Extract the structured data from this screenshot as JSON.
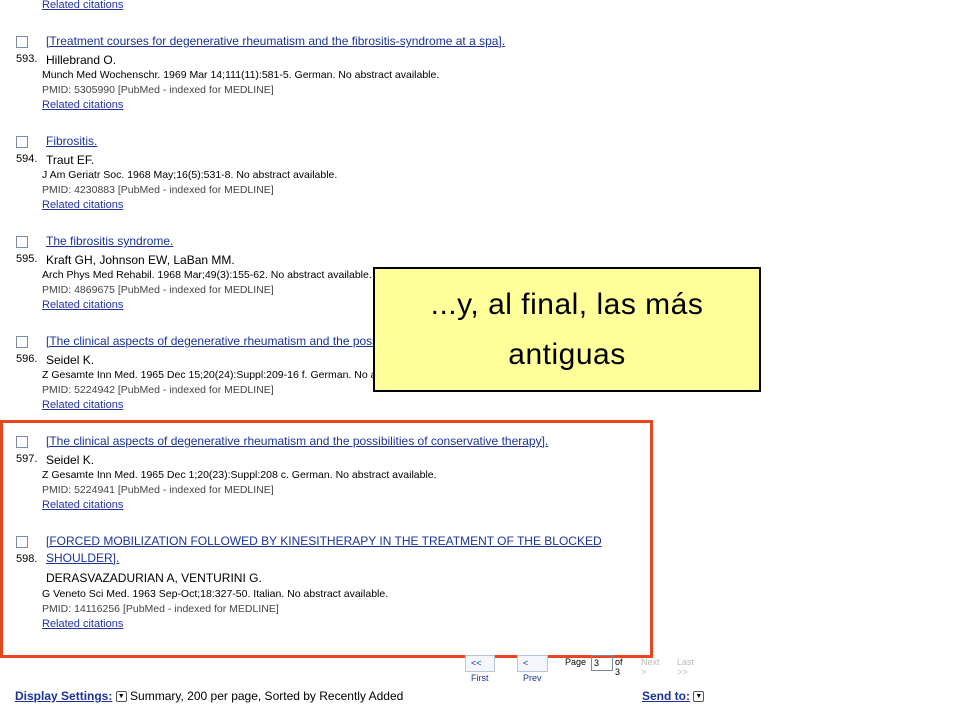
{
  "top_related": "Related citations",
  "records": [
    {
      "num": "593.",
      "title": "[Treatment courses for degenerative rheumatism and the fibrositis-syndrome at a spa].",
      "authors": "Hillebrand O.",
      "source": "Munch Med Wochenschr. 1969 Mar 14;111(11):581-5. German. No abstract available.",
      "pmid": "PMID: 5305990 [PubMed - indexed for MEDLINE]",
      "related": "Related citations"
    },
    {
      "num": "594.",
      "title": "Fibrositis.",
      "authors": "Traut EF.",
      "source": "J Am Geriatr Soc. 1968 May;16(5):531-8. No abstract available.",
      "pmid": "PMID: 4230883 [PubMed - indexed for MEDLINE]",
      "related": "Related citations"
    },
    {
      "num": "595.",
      "title": "The fibrositis syndrome.",
      "authors": "Kraft GH, Johnson EW, LaBan MM.",
      "source": "Arch Phys Med Rehabil. 1968 Mar;49(3):155-62. No abstract available.",
      "pmid": "PMID: 4869675 [PubMed - indexed for MEDLINE]",
      "related": "Related citations"
    },
    {
      "num": "596.",
      "title": "[The clinical aspects of degenerative rheumatism and the possibilities of conservative therapy].",
      "authors": "Seidel K.",
      "source": "Z Gesamte Inn Med. 1965 Dec 15;20(24):Suppl:209-16 f. German. No abstract available.",
      "pmid": "PMID: 5224942 [PubMed - indexed for MEDLINE]",
      "related": "Related citations"
    },
    {
      "num": "597.",
      "title": "[The clinical aspects of degenerative rheumatism and the possibilities of conservative therapy].",
      "authors": "Seidel K.",
      "source": "Z Gesamte Inn Med. 1965 Dec 1;20(23):Suppl:208 c. German. No abstract available.",
      "pmid": "PMID: 5224941 [PubMed - indexed for MEDLINE]",
      "related": "Related citations"
    },
    {
      "num": "598.",
      "title": "[FORCED MOBILIZATION FOLLOWED BY KINESITHERAPY IN THE TREATMENT OF THE BLOCKED",
      "title2": "SHOULDER].",
      "authors": "DERASVAZADURIAN A, VENTURINI G.",
      "source": "G Veneto Sci Med. 1963 Sep-Oct;18:327-50. Italian. No abstract available.",
      "pmid": "PMID: 14116256 [PubMed - indexed for MEDLINE]",
      "related": "Related citations"
    }
  ],
  "callout": {
    "line1": "...y, al final, las más",
    "line2": "antiguas"
  },
  "pager": {
    "first": "<< First",
    "prev": "< Prev",
    "page_label": "Page",
    "page_value": "3",
    "of": "of 3",
    "next": "Next >",
    "last": "Last >>"
  },
  "display_settings": {
    "label": "Display Settings:",
    "value": "Summary, 200 per page, Sorted by Recently Added"
  },
  "send_to": {
    "label": "Send to:"
  },
  "colors": {
    "highlight_border": "#e8471d",
    "callout_bg": "#ffff99",
    "link": "#1a3399"
  }
}
